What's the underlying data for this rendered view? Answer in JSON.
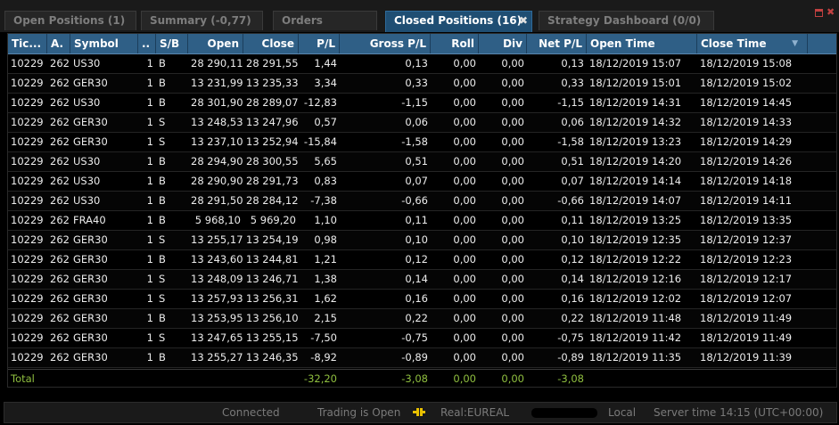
{
  "tabs": [
    {
      "label": "Open Positions (1)"
    },
    {
      "label": "Summary (-0,77)"
    },
    {
      "label": "Orders"
    },
    {
      "label": "Closed Positions (16)",
      "active": true
    },
    {
      "label": "Strategy Dashboard (0/0)"
    }
  ],
  "tab_close_glyph": "✖",
  "columns": [
    "Tic...",
    "A.",
    "Symbol",
    "..",
    "S/B",
    "Open",
    "Close",
    "P/L",
    "Gross P/L",
    "Roll",
    "Div",
    "Net P/L",
    "Open Time",
    "Close Time"
  ],
  "sort_icon_glyph": "▼",
  "rows": [
    [
      "10229",
      "262",
      "US30",
      "1",
      "B",
      "28 290,11",
      "28 291,55",
      "1,44",
      "0,13",
      "0,00",
      "0,00",
      "0,13",
      "18/12/2019 15:07",
      "18/12/2019 15:08"
    ],
    [
      "10229",
      "262",
      "GER30",
      "1",
      "B",
      "13 231,99",
      "13 235,33",
      "3,34",
      "0,33",
      "0,00",
      "0,00",
      "0,33",
      "18/12/2019 15:01",
      "18/12/2019 15:02"
    ],
    [
      "10229",
      "262",
      "US30",
      "1",
      "B",
      "28 301,90",
      "28 289,07",
      "-12,83",
      "-1,15",
      "0,00",
      "0,00",
      "-1,15",
      "18/12/2019 14:31",
      "18/12/2019 14:45"
    ],
    [
      "10229",
      "262",
      "GER30",
      "1",
      "S",
      "13 248,53",
      "13 247,96",
      "0,57",
      "0,06",
      "0,00",
      "0,00",
      "0,06",
      "18/12/2019 14:32",
      "18/12/2019 14:33"
    ],
    [
      "10229",
      "262",
      "GER30",
      "1",
      "S",
      "13 237,10",
      "13 252,94",
      "-15,84",
      "-1,58",
      "0,00",
      "0,00",
      "-1,58",
      "18/12/2019 13:23",
      "18/12/2019 14:29"
    ],
    [
      "10229",
      "262",
      "US30",
      "1",
      "B",
      "28 294,90",
      "28 300,55",
      "5,65",
      "0,51",
      "0,00",
      "0,00",
      "0,51",
      "18/12/2019 14:20",
      "18/12/2019 14:26"
    ],
    [
      "10229",
      "262",
      "US30",
      "1",
      "B",
      "28 290,90",
      "28 291,73",
      "0,83",
      "0,07",
      "0,00",
      "0,00",
      "0,07",
      "18/12/2019 14:14",
      "18/12/2019 14:18"
    ],
    [
      "10229",
      "262",
      "US30",
      "1",
      "B",
      "28 291,50",
      "28 284,12",
      "-7,38",
      "-0,66",
      "0,00",
      "0,00",
      "-0,66",
      "18/12/2019 14:07",
      "18/12/2019 14:11"
    ],
    [
      "10229",
      "262",
      "FRA40",
      "1",
      "B",
      "5 968,10",
      "5 969,20",
      "1,10",
      "0,11",
      "0,00",
      "0,00",
      "0,11",
      "18/12/2019 13:25",
      "18/12/2019 13:35"
    ],
    [
      "10229",
      "262",
      "GER30",
      "1",
      "S",
      "13 255,17",
      "13 254,19",
      "0,98",
      "0,10",
      "0,00",
      "0,00",
      "0,10",
      "18/12/2019 12:35",
      "18/12/2019 12:37"
    ],
    [
      "10229",
      "262",
      "GER30",
      "1",
      "B",
      "13 243,60",
      "13 244,81",
      "1,21",
      "0,12",
      "0,00",
      "0,00",
      "0,12",
      "18/12/2019 12:22",
      "18/12/2019 12:23"
    ],
    [
      "10229",
      "262",
      "GER30",
      "1",
      "S",
      "13 248,09",
      "13 246,71",
      "1,38",
      "0,14",
      "0,00",
      "0,00",
      "0,14",
      "18/12/2019 12:16",
      "18/12/2019 12:17"
    ],
    [
      "10229",
      "262",
      "GER30",
      "1",
      "S",
      "13 257,93",
      "13 256,31",
      "1,62",
      "0,16",
      "0,00",
      "0,00",
      "0,16",
      "18/12/2019 12:02",
      "18/12/2019 12:07"
    ],
    [
      "10229",
      "262",
      "GER30",
      "1",
      "B",
      "13 253,95",
      "13 256,10",
      "2,15",
      "0,22",
      "0,00",
      "0,00",
      "0,22",
      "18/12/2019 11:48",
      "18/12/2019 11:49"
    ],
    [
      "10229",
      "262",
      "GER30",
      "1",
      "S",
      "13 247,65",
      "13 255,15",
      "-7,50",
      "-0,75",
      "0,00",
      "0,00",
      "-0,75",
      "18/12/2019 11:42",
      "18/12/2019 11:49"
    ],
    [
      "10229",
      "262",
      "GER30",
      "1",
      "B",
      "13 255,27",
      "13 246,35",
      "-8,92",
      "-0,89",
      "0,00",
      "0,00",
      "-0,89",
      "18/12/2019 11:35",
      "18/12/2019 11:39"
    ]
  ],
  "total": {
    "label": "Total",
    "pl": "-32,20",
    "gross_pl": "-3,08",
    "roll": "0,00",
    "div": "0,00",
    "net_pl": "-3,08"
  },
  "status": {
    "connection": "Connected",
    "trading": "Trading is Open",
    "account": "Real:EUREAL",
    "locale": "Local",
    "server_time": "Server time 14:15 (UTC+00:00)"
  },
  "colors": {
    "header_bg": "#2f5f86",
    "active_tab_bg": "#1f4e73",
    "total_text": "#8fbf3f",
    "plug_icon": "#e8c000"
  }
}
